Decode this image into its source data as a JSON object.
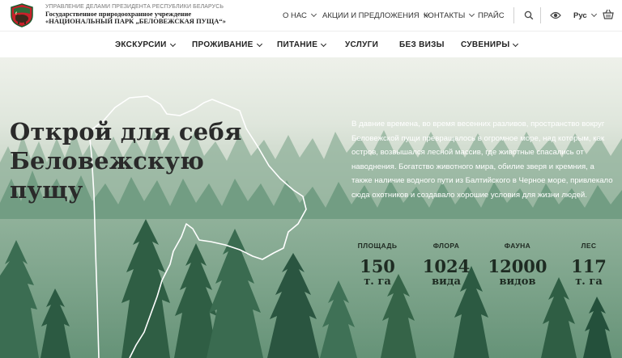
{
  "org": {
    "department": "УПРАВЛЕНИЕ ДЕЛАМИ ПРЕЗИДЕНТА РЕСПУБЛИКИ БЕЛАРУСЬ",
    "line1": "Государственное природоохранное учреждение",
    "line2": "«НАЦИОНАЛЬНЫЙ ПАРК „БЕЛОВЕЖСКАЯ ПУЩА“»",
    "logo_icon": "bison-emblem-icon"
  },
  "top_nav": {
    "items": [
      {
        "label": "О НАС"
      },
      {
        "label": "АКЦИИ И ПРЕДЛОЖЕНИЯ"
      },
      {
        "label": "КОНТАКТЫ"
      },
      {
        "label": "ПРАЙС"
      }
    ],
    "search_icon": "search-icon",
    "accessibility_icon": "eye-icon",
    "language": "Рус",
    "cart_icon": "basket-icon"
  },
  "main_nav": {
    "items": [
      {
        "label": "ЭКСКУРСИИ"
      },
      {
        "label": "ПРОЖИВАНИЕ"
      },
      {
        "label": "ПИТАНИЕ"
      },
      {
        "label": "УСЛУГИ"
      },
      {
        "label": "БЕЗ ВИЗЫ"
      },
      {
        "label": "СУВЕНИРЫ"
      }
    ]
  },
  "hero": {
    "title_line1": "Открой для себя",
    "title_line2": "Беловежскую пущу",
    "text": "В давние времена, во время весенних разливов, пространство вокруг Беловежской пущи превращалось в огромное море, над которым, как остров, возвышался лесной массив, где животные спасались от наводнения. Богатство животного мира, обилие зверя и кремния, а также наличие водного пути из Балтийского в Черное море, привлекало сюда охотников и создавало хорошие условия для жизни людей."
  },
  "stats": [
    {
      "label": "ПЛОЩАДЬ",
      "value": "150",
      "unit": "т. га"
    },
    {
      "label": "ФЛОРА",
      "value": "1024",
      "unit": "вида"
    },
    {
      "label": "ФАУНА",
      "value": "12000",
      "unit": "видов"
    },
    {
      "label": "ЛЕС",
      "value": "117",
      "unit": "т. га"
    }
  ],
  "colors": {
    "forest_dark": "#2f5e44",
    "forest_light": "#6f9b7f",
    "title_text": "#2a2a2a"
  }
}
